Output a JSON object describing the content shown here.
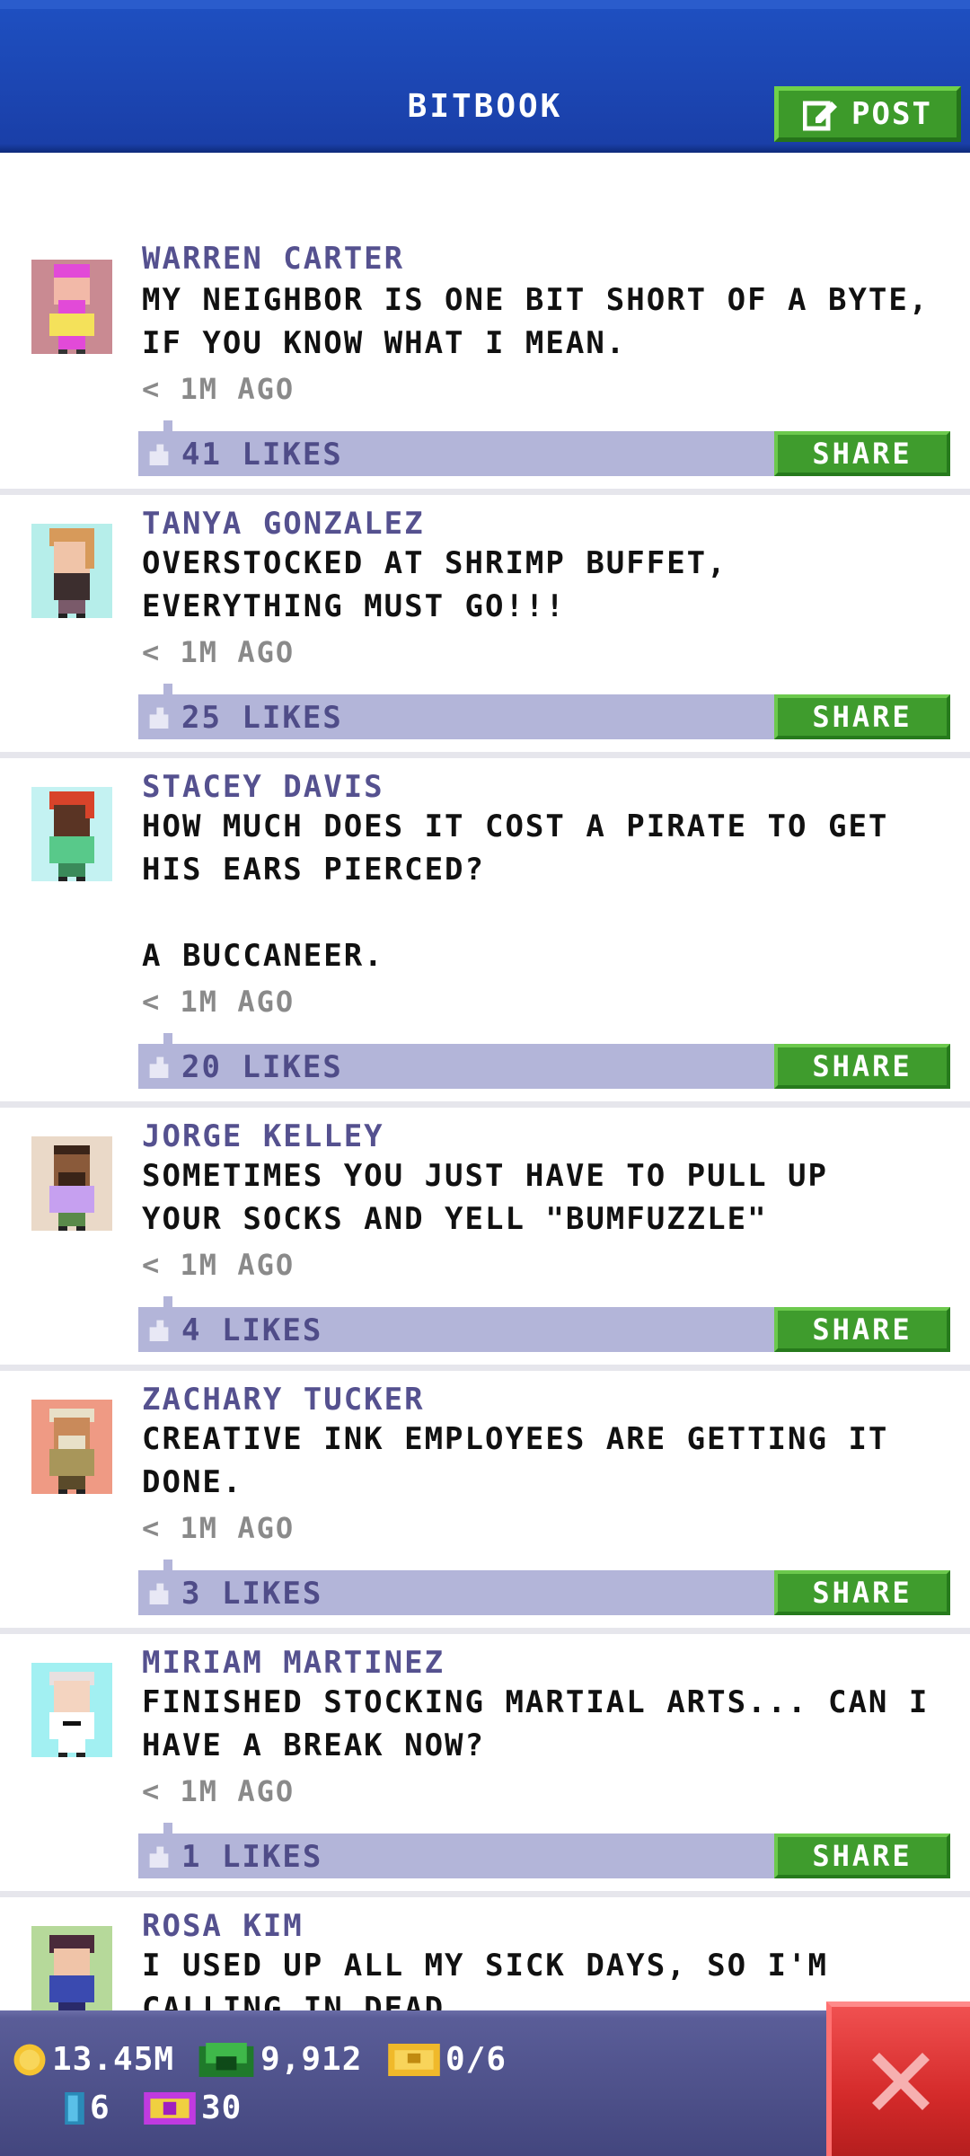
{
  "header": {
    "title": "BITBOOK",
    "post_label": "POST"
  },
  "posts": [
    {
      "name": "WARREN CARTER",
      "message": "MY NEIGHBOR IS ONE BIT SHORT OF A BYTE,\nIF YOU KNOW WHAT I MEAN.",
      "time": "< 1M AGO",
      "likes": "41 LIKES",
      "share_label": "SHARE",
      "avatar_bg": "#c98a92"
    },
    {
      "name": "TANYA GONZALEZ",
      "message": "OVERSTOCKED AT SHRIMP BUFFET,\nEVERYTHING MUST GO!!!",
      "time": "< 1M AGO",
      "likes": "25 LIKES",
      "share_label": "SHARE",
      "avatar_bg": "#b6eeea"
    },
    {
      "name": "STACEY DAVIS",
      "message": "HOW MUCH DOES IT COST A PIRATE TO GET\nHIS EARS PIERCED?\n\nA BUCCANEER.",
      "time": "< 1M AGO",
      "likes": "20 LIKES",
      "share_label": "SHARE",
      "avatar_bg": "#c4f2f2"
    },
    {
      "name": "JORGE KELLEY",
      "message": "SOMETIMES YOU JUST HAVE TO PULL UP\nYOUR SOCKS AND YELL \"BUMFUZZLE\"",
      "time": "< 1M AGO",
      "likes": "4 LIKES",
      "share_label": "SHARE",
      "avatar_bg": "#ead9c8"
    },
    {
      "name": "ZACHARY TUCKER",
      "message": "CREATIVE INK EMPLOYEES ARE GETTING IT\nDONE.",
      "time": "< 1M AGO",
      "likes": "3 LIKES",
      "share_label": "SHARE",
      "avatar_bg": "#ef9a84"
    },
    {
      "name": "MIRIAM MARTINEZ",
      "message": "FINISHED STOCKING MARTIAL ARTS... CAN I\nHAVE A BREAK NOW?",
      "time": "< 1M AGO",
      "likes": "1 LIKES",
      "share_label": "SHARE",
      "avatar_bg": "#a2f0f2"
    },
    {
      "name": "ROSA KIM",
      "message": "I USED UP ALL MY SICK DAYS, SO I'M\nCALLING IN DEAD.",
      "time": "",
      "likes": "",
      "share_label": "",
      "avatar_bg": "#b6d99a"
    }
  ],
  "status": {
    "coins": "13.45M",
    "bux": "9,912",
    "tickets": "0/6",
    "gems": "6",
    "vip": "30"
  },
  "colors": {
    "header_blue": "#1a3fa8",
    "share_green": "#3f9c2d",
    "like_bar": "#b3b5d9",
    "name_purple": "#55518f",
    "close_red": "#d42a2a"
  }
}
